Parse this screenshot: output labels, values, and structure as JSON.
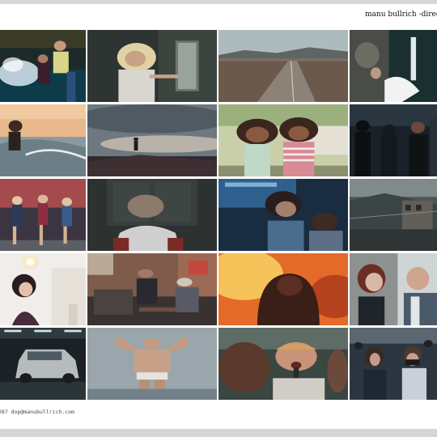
{
  "header": {
    "title": "manu bullrich -director of p"
  },
  "footer": {
    "contact": "287 dop@manubullrich.com"
  },
  "frames": [
    {
      "name": "frame-surf-splash"
    },
    {
      "name": "frame-blonde-woman-mirror"
    },
    {
      "name": "frame-desert-road"
    },
    {
      "name": "frame-hand-on-glass"
    },
    {
      "name": "frame-surfer-sunset"
    },
    {
      "name": "frame-silhouette-on-hill"
    },
    {
      "name": "frame-two-girls"
    },
    {
      "name": "frame-dark-crowd"
    },
    {
      "name": "frame-women-running"
    },
    {
      "name": "frame-boy-dark-room"
    },
    {
      "name": "frame-woman-blue-light"
    },
    {
      "name": "frame-hillside-town"
    },
    {
      "name": "frame-woman-chandelier"
    },
    {
      "name": "frame-men-on-sofa"
    },
    {
      "name": "frame-hooded-figure-fire"
    },
    {
      "name": "frame-couple-in-car"
    },
    {
      "name": "frame-car-showroom"
    },
    {
      "name": "frame-flexing-man"
    },
    {
      "name": "frame-man-shouting"
    },
    {
      "name": "frame-audience-watching"
    }
  ]
}
